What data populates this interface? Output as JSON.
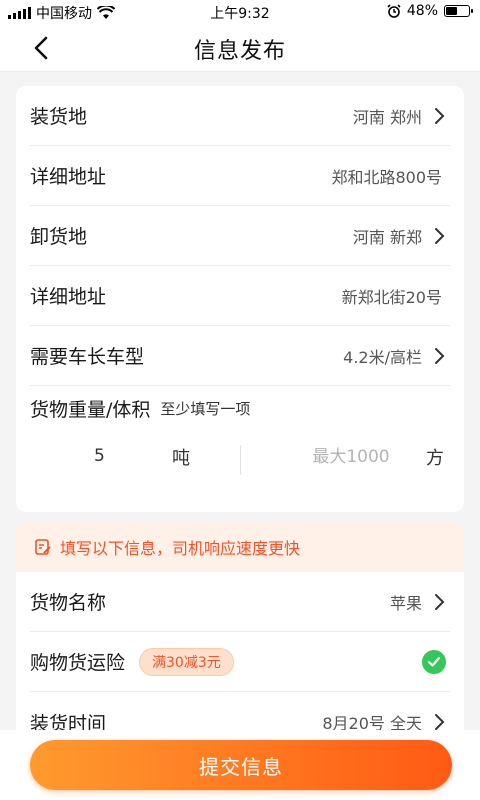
{
  "status_bar": {
    "carrier": "中国移动",
    "time": "上午9:32",
    "battery_percent": "48%",
    "battery_level": 0.48
  },
  "nav": {
    "title": "信息发布"
  },
  "form": {
    "load_place": {
      "label": "装货地",
      "value": "河南 郑州"
    },
    "load_address": {
      "label": "详细地址",
      "value": "郑和北路800号"
    },
    "unload_place": {
      "label": "卸货地",
      "value": "河南 新郑"
    },
    "unload_address": {
      "label": "详细地址",
      "value": "新郑北街20号"
    },
    "vehicle": {
      "label": "需要车长车型",
      "value": "4.2米/高栏"
    },
    "weight_volume": {
      "label": "货物重量/体积",
      "hint": "至少填写一项",
      "weight_value": "5",
      "weight_unit": "吨",
      "volume_placeholder": "最大1000",
      "volume_unit": "方"
    }
  },
  "extra": {
    "tip": "填写以下信息，司机响应速度更快",
    "goods_name": {
      "label": "货物名称",
      "value": "苹果"
    },
    "insurance": {
      "label": "购物货运险",
      "badge": "满30减3元",
      "checked": true
    },
    "load_time": {
      "label": "装货时间",
      "value": "8月20号 全天"
    }
  },
  "submit_label": "提交信息",
  "colors": {
    "accent": "#f0542a",
    "button_start": "#ff9a2e",
    "button_end": "#ff5a14",
    "check": "#34c759"
  }
}
